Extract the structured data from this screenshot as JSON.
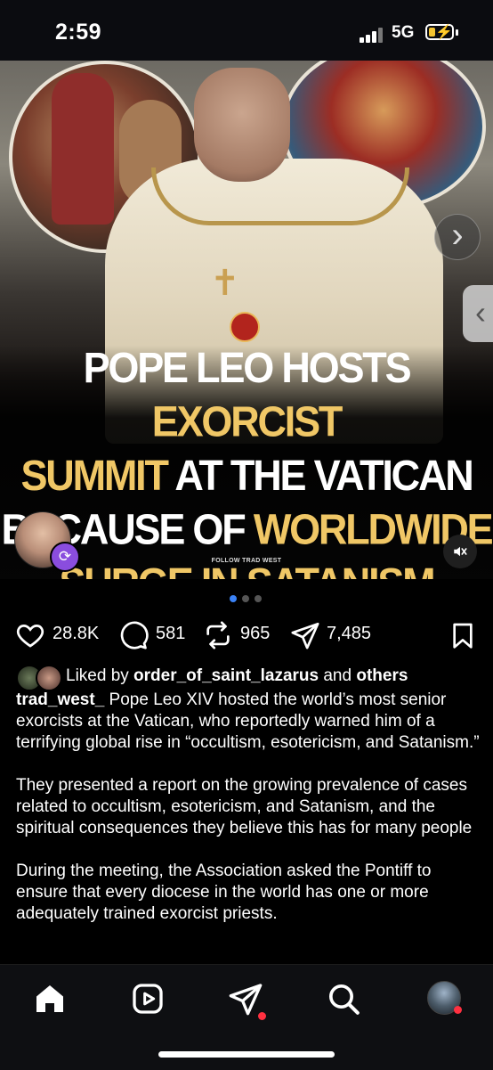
{
  "status_bar": {
    "time": "2:59",
    "network": "5G",
    "battery_charging": true,
    "accent": "#f4c430"
  },
  "post": {
    "image": {
      "headline_line1_white": "POPE LEO HOSTS ",
      "headline_line1_gold": "EXORCIST",
      "headline_line2_gold": "SUMMIT",
      "headline_line2_white": " AT THE VATICAN",
      "headline_line3_white": "BECAUSE OF ",
      "headline_line3_gold": "WORLDWIDE",
      "headline_line4_gold": "SURGE IN SATANISM",
      "footer": "FOLLOW TRAD WEST",
      "gold_color": "#f0c766",
      "icons": [
        "next-chevron-icon",
        "side-collapse-icon",
        "repost-icon",
        "mute-icon"
      ]
    },
    "carousel": {
      "total": 3,
      "active": 0
    },
    "actions": {
      "likes": "28.8K",
      "comments": "581",
      "reposts": "965",
      "shares": "7,485"
    },
    "liked_by": {
      "prefix": "Liked by ",
      "user": "order_of_saint_lazarus",
      "middle": " and ",
      "others": "others"
    },
    "caption": {
      "username": "trad_west_",
      "para1": " Pope Leo XIV hosted the world’s most senior exorcists at the Vatican, who reportedly warned him of a terrifying global rise in “occultism, esotericism, and Satanism.”",
      "para2": "They presented a report on the growing prevalence of cases related to occultism, esotericism, and Satanism, and the spiritual consequences they believe this has for many people",
      "para3": "During the meeting, the Association asked the Pontiff to ensure that every diocese in the world has one or more adequately trained exorcist priests."
    }
  },
  "nav": {
    "items": [
      "home-icon",
      "reels-icon",
      "direct-messages-icon",
      "search-icon",
      "profile-avatar"
    ],
    "notification_color": "#ff3040"
  }
}
